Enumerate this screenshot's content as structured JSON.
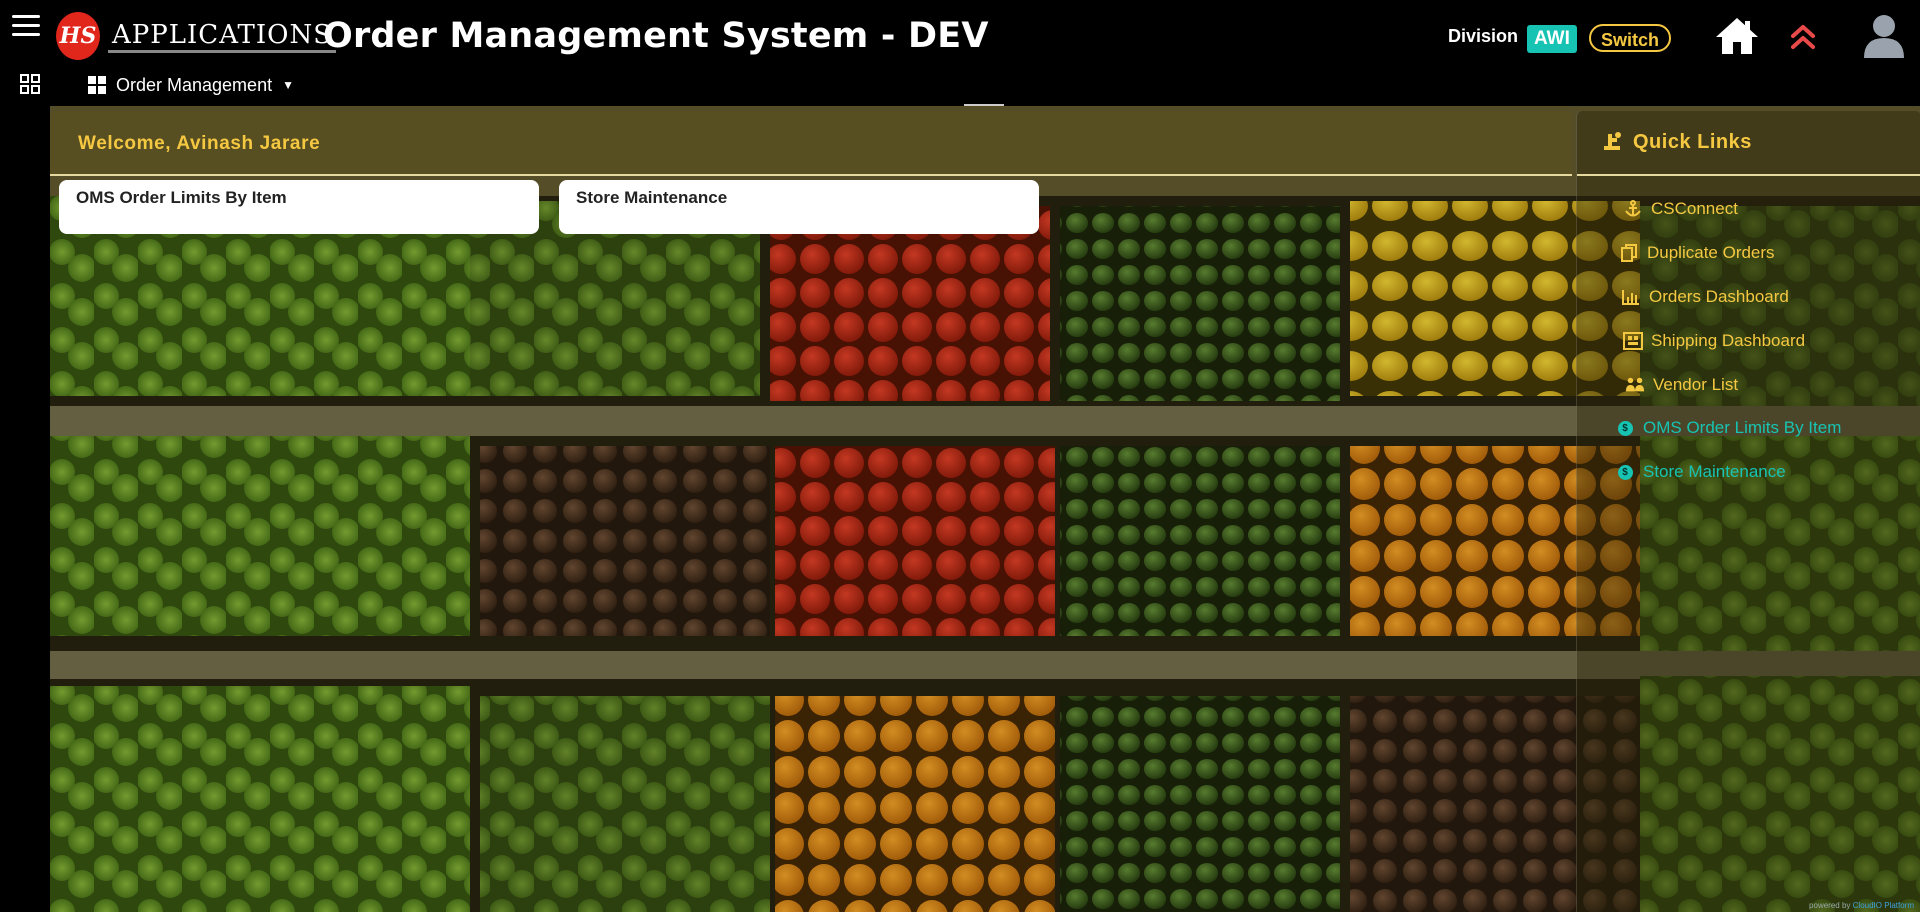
{
  "header": {
    "logo_text": "APPLICATIONS",
    "app_title": "Order Management System - DEV",
    "division_label": "Division",
    "division_value": "AWI",
    "switch_label": "Switch"
  },
  "nav": {
    "menu_label": "Order Management"
  },
  "welcome": {
    "text": "Welcome, Avinash Jarare"
  },
  "cards": [
    {
      "title": "OMS Order Limits By Item"
    },
    {
      "title": "Store Maintenance"
    }
  ],
  "quick_links": {
    "title": "Quick Links",
    "items": [
      {
        "label": "CSConnect",
        "icon": "anchor-icon",
        "color": "#f5c842"
      },
      {
        "label": "Duplicate Orders",
        "icon": "copy-icon",
        "color": "#f5c842"
      },
      {
        "label": "Orders Dashboard",
        "icon": "bar-chart-icon",
        "color": "#f5c842"
      },
      {
        "label": "Shipping Dashboard",
        "icon": "pallet-icon",
        "color": "#f5c842"
      },
      {
        "label": "Vendor List",
        "icon": "people-icon",
        "color": "#f5c842"
      },
      {
        "label": "OMS Order Limits By Item",
        "icon": "dollar-circle-icon",
        "color": "#17c3b2"
      },
      {
        "label": "Store Maintenance",
        "icon": "dollar-circle-icon",
        "color": "#17c3b2"
      }
    ]
  },
  "footer": {
    "powered_prefix": "powered by",
    "powered_brand": "CloudIO Platform"
  },
  "colors": {
    "accent_gold": "#f5c842",
    "accent_teal": "#17c3b2",
    "alert_red": "#e84a4a",
    "logo_red": "#e1261c"
  }
}
